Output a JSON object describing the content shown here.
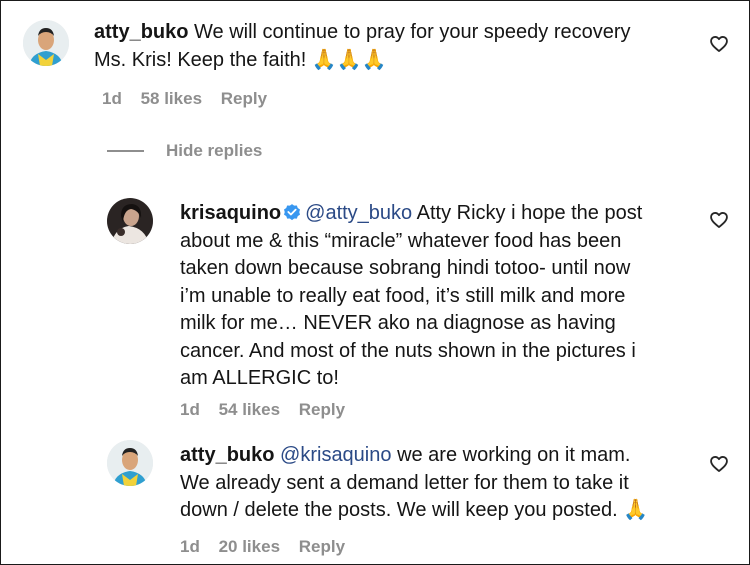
{
  "comments": [
    {
      "username": "atty_buko",
      "lines": [
        "We will continue to pray for your speedy recovery",
        "Ms. Kris! Keep the faith! 🙏🙏🙏"
      ],
      "time": "1d",
      "likes": "58 likes",
      "reply": "Reply"
    },
    {
      "username": "krisaquino",
      "verified": true,
      "mention": "@atty_buko",
      "lines": [
        "Atty Ricky i hope the post",
        "about me & this “miracle” whatever food has been",
        "taken down because sobrang hindi totoo- until now",
        "i’m unable to really eat food, it’s still milk and more",
        "milk for me… NEVER ako na diagnose as having",
        "cancer. And most of the nuts shown in the pictures i",
        "am ALLERGIC to!"
      ],
      "time": "1d",
      "likes": "54 likes",
      "reply": "Reply"
    },
    {
      "username": "atty_buko",
      "mention": "@krisaquino",
      "lines": [
        "we are working on it mam.",
        "We already sent a demand letter for them to take it",
        "down / delete the posts. We will keep you posted. 🙏"
      ],
      "time": "1d",
      "likes": "20 likes",
      "reply": "Reply"
    }
  ],
  "hide_replies_label": "Hide replies",
  "icons": {
    "like": "heart-outline-icon",
    "verified": "verified-badge-icon"
  },
  "colors": {
    "text": "#151515",
    "muted": "#8e8e8e",
    "mention": "#2b4a86",
    "verified": "#3897f0"
  }
}
